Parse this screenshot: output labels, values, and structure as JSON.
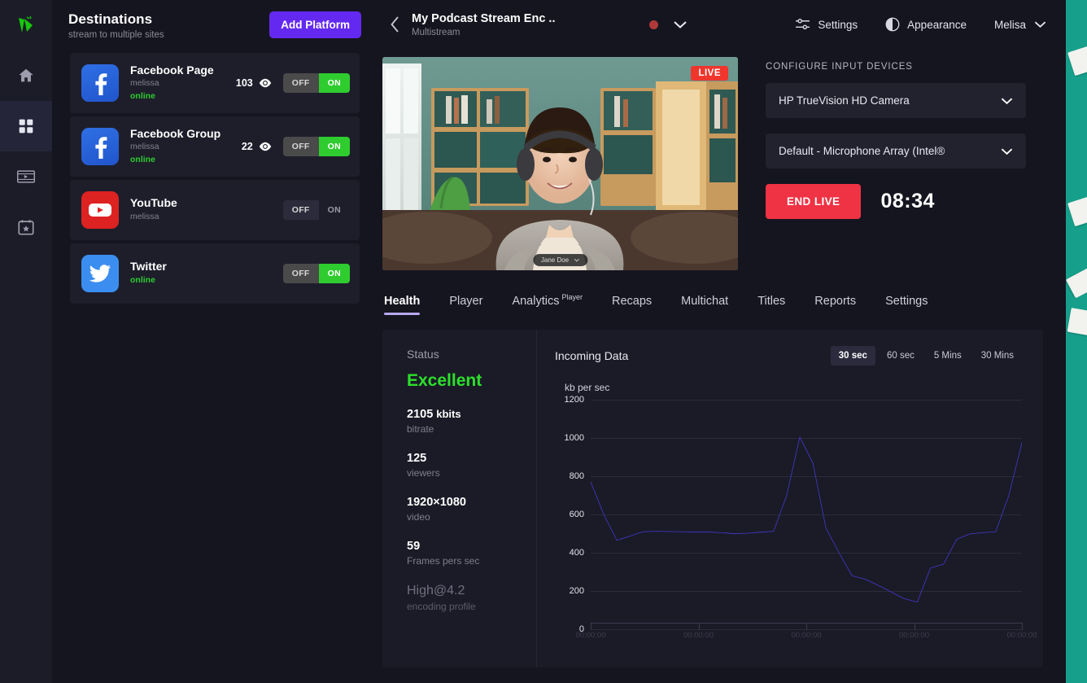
{
  "backdrop": {
    "color": "#16a08c"
  },
  "rail": {
    "logo": "logo-icon",
    "items": [
      {
        "name": "home-icon",
        "label": "Home",
        "active": false
      },
      {
        "name": "grid-icon",
        "label": "Dashboard",
        "active": true
      },
      {
        "name": "video-icon",
        "label": "Videos",
        "active": false
      },
      {
        "name": "calendar-star-icon",
        "label": "Schedule",
        "active": false
      }
    ]
  },
  "destinations": {
    "title": "Destinations",
    "subtitle": "stream to multiple sites",
    "add_button": "Add Platform",
    "items": [
      {
        "platform": "facebook",
        "name": "Facebook Page",
        "user": "melissa",
        "status": "online",
        "viewers": "103",
        "toggle": {
          "off": "OFF",
          "on": "ON",
          "state": "on"
        }
      },
      {
        "platform": "facebook",
        "name": "Facebook Group",
        "user": "melissa",
        "status": "online",
        "viewers": "22",
        "toggle": {
          "off": "OFF",
          "on": "ON",
          "state": "on"
        }
      },
      {
        "platform": "youtube",
        "name": "YouTube",
        "user": "melissa",
        "status": "",
        "viewers": "",
        "toggle": {
          "off": "OFF",
          "on": "ON",
          "state": "off"
        }
      },
      {
        "platform": "twitter",
        "name": "Twitter",
        "user": "",
        "status": "online",
        "viewers": "",
        "toggle": {
          "off": "OFF",
          "on": "ON",
          "state": "on"
        }
      }
    ]
  },
  "topbar": {
    "back": "back-arrow-icon",
    "stream_name": "My Podcast Stream Enc  ..",
    "stream_type": "Multistream",
    "settings": "Settings",
    "appearance": "Appearance",
    "user": "Melisa"
  },
  "video": {
    "live_badge": "LIVE",
    "name_tag": "Jane Doe"
  },
  "inputs": {
    "label": "CONFIGURE INPUT DEVICES",
    "camera": "HP TrueVision HD Camera",
    "microphone": "Default - Microphone Array (Intel®",
    "end_live": "END LIVE",
    "timer": "08:34"
  },
  "tabs": [
    {
      "label": "Health",
      "sup": "",
      "active": true
    },
    {
      "label": "Player",
      "sup": "",
      "active": false
    },
    {
      "label": "Analytics",
      "sup": "Player",
      "active": false
    },
    {
      "label": "Recaps",
      "sup": "",
      "active": false
    },
    {
      "label": "Multichat",
      "sup": "",
      "active": false
    },
    {
      "label": "Titles",
      "sup": "",
      "active": false
    },
    {
      "label": "Reports",
      "sup": "",
      "active": false
    },
    {
      "label": "Settings",
      "sup": "",
      "active": false
    }
  ],
  "health": {
    "status_label": "Status",
    "status_value": "Excellent",
    "metrics": [
      {
        "value": "2105",
        "unit": "kbits",
        "label": "bitrate",
        "dim": false
      },
      {
        "value": "125",
        "unit": "",
        "label": "viewers",
        "dim": false
      },
      {
        "value": "1920×1080",
        "unit": "",
        "label": "video",
        "dim": false
      },
      {
        "value": "59",
        "unit": "",
        "label": "Frames pers sec",
        "dim": false
      },
      {
        "value": "High@4.2",
        "unit": "",
        "label": "encoding profile",
        "dim": true
      }
    ]
  },
  "chart_data": {
    "type": "line",
    "title": "Incoming Data",
    "ylabel": "kb per sec",
    "xlabel": "",
    "ylim": [
      0,
      1200
    ],
    "yticks": [
      0,
      200,
      400,
      600,
      800,
      1000,
      1200
    ],
    "grid": true,
    "legend": null,
    "line_color": "#4b3df0",
    "ranges": [
      {
        "label": "30 sec",
        "active": true
      },
      {
        "label": "60 sec",
        "active": false
      },
      {
        "label": "5 Mins",
        "active": false
      },
      {
        "label": "30 Mins",
        "active": false
      }
    ],
    "x": [
      0,
      1,
      2,
      3,
      4,
      5,
      6,
      7,
      8,
      9,
      10,
      11,
      12,
      13,
      14,
      15,
      16,
      17,
      18,
      19,
      20,
      21,
      22,
      23,
      24,
      25,
      26,
      27,
      28,
      29
    ],
    "values": [
      770,
      600,
      465,
      487,
      510,
      512,
      511,
      510,
      509,
      508,
      505,
      500,
      502,
      508,
      512,
      700,
      1005,
      870,
      530,
      400,
      280,
      262,
      230,
      195,
      160,
      142,
      320,
      340,
      470,
      498,
      505,
      510,
      700,
      975
    ],
    "xticklabels": [
      "00:00:00",
      "00:00:00",
      "00:00:00",
      "00:00:00",
      "00:00:00"
    ]
  }
}
